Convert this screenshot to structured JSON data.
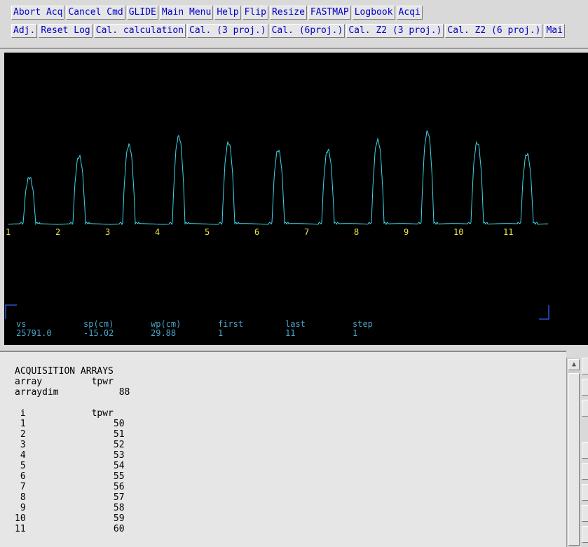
{
  "toolbar": {
    "row1": [
      "Abort Acq",
      "Cancel Cmd",
      "GLIDE",
      "Main Menu",
      "Help",
      "Flip",
      "Resize",
      "FASTMAP",
      "Logbook",
      "Acqi"
    ],
    "row2": [
      "Adj.",
      "Reset Log",
      "Cal. calculation",
      "Cal. (3 proj.)",
      "Cal. (6proj.)",
      "Cal. Z2 (3 proj.)",
      "Cal. Z2 (6 proj.)",
      "Mai"
    ]
  },
  "spectrum": {
    "trace_color": "#3fd6e8",
    "label_color": "#e8e84a",
    "array_labels": [
      "1",
      "2",
      "3",
      "4",
      "5",
      "6",
      "7",
      "8",
      "9",
      "10",
      "11"
    ],
    "peak_heights": [
      0.38,
      0.55,
      0.64,
      0.71,
      0.66,
      0.6,
      0.6,
      0.68,
      0.75,
      0.66,
      0.57
    ]
  },
  "params": {
    "labels": [
      "vs",
      "sp(cm)",
      "wp(cm)",
      "first",
      "last",
      "step"
    ],
    "values": [
      "25791.0",
      "-15.02",
      "29.88",
      "1",
      "11",
      "1"
    ]
  },
  "text_output": {
    "title": "ACQUISITION ARRAYS",
    "array_label": "array",
    "array_value": "tpwr",
    "dim_label": "arraydim",
    "dim_value": "88",
    "col_i": "i",
    "col_tpwr": "tpwr",
    "rows": [
      [
        "1",
        "50"
      ],
      [
        "2",
        "51"
      ],
      [
        "3",
        "52"
      ],
      [
        "4",
        "53"
      ],
      [
        "5",
        "54"
      ],
      [
        "6",
        "55"
      ],
      [
        "7",
        "56"
      ],
      [
        "8",
        "57"
      ],
      [
        "9",
        "58"
      ],
      [
        "10",
        "59"
      ],
      [
        "11",
        "60"
      ]
    ]
  },
  "scrollbar": {
    "up_icon": "arrow-up-icon"
  }
}
